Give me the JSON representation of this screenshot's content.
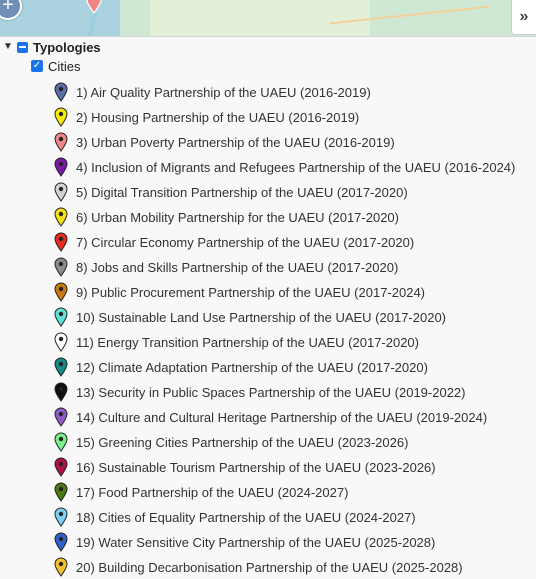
{
  "map": {
    "zoom_in_label": "+",
    "panel_toggle_label": "»"
  },
  "tree": {
    "typologies_label": "Typologies",
    "cities_label": "Cities",
    "items": [
      {
        "label": "1) Air Quality Partnership of the UAEU (2016-2019)",
        "color": "#5a6ea8",
        "icon": "map-pin-icon"
      },
      {
        "label": "2) Housing Partnership of the UAEU (2016-2019)",
        "color": "#f5ec0b",
        "icon": "map-pin-icon"
      },
      {
        "label": "3) Urban Poverty Partnership of the UAEU (2016-2019)",
        "color": "#f08585",
        "icon": "map-pin-icon"
      },
      {
        "label": "4) Inclusion of Migrants and Refugees Partnership of the UAEU (2016-2024)",
        "color": "#7a1aa6",
        "icon": "map-pin-icon"
      },
      {
        "label": "5) Digital Transition Partnership of the UAEU (2017-2020)",
        "color": "#d4d4d4",
        "icon": "map-pin-icon"
      },
      {
        "label": "6) Urban Mobility Partnership for the UAEU (2017-2020)",
        "color": "#f4e017",
        "icon": "map-pin-icon"
      },
      {
        "label": "7) Circular Economy Partnership of the UAEU (2017-2020)",
        "color": "#ea2a1e",
        "icon": "map-pin-icon"
      },
      {
        "label": "8) Jobs and Skills Partnership of the UAEU (2017-2020)",
        "color": "#8c8c8c",
        "icon": "map-pin-icon"
      },
      {
        "label": "9) Public Procurement Partnership of the UAEU (2017-2024)",
        "color": "#c97a10",
        "icon": "map-pin-icon"
      },
      {
        "label": "10) Sustainable Land Use Partnership of the UAEU (2017-2020)",
        "color": "#5fe0da",
        "icon": "map-pin-icon"
      },
      {
        "label": "11) Energy Transition Partnership of the UAEU (2017-2020)",
        "color": "#ffffff",
        "icon": "map-pin-icon"
      },
      {
        "label": "12) Climate Adaptation Partnership of the UAEU (2017-2020)",
        "color": "#168a84",
        "icon": "map-pin-icon"
      },
      {
        "label": "13) Security in Public Spaces Partnership of the UAEU (2019-2022)",
        "color": "#111111",
        "icon": "map-pin-icon"
      },
      {
        "label": "14) Culture and Cultural Heritage Partnership of the UAEU (2019-2024)",
        "color": "#8e5ac8",
        "icon": "map-pin-icon"
      },
      {
        "label": "15) Greening Cities Partnership of the UAEU (2023-2026)",
        "color": "#7df08a",
        "icon": "map-pin-icon"
      },
      {
        "label": "16) Sustainable Tourism Partnership of the UAEU (2023-2026)",
        "color": "#b0124e",
        "icon": "map-pin-icon"
      },
      {
        "label": "17) Food Partnership of the UAEU (2024-2027)",
        "color": "#4a7a12",
        "icon": "map-pin-icon"
      },
      {
        "label": "18) Cities of Equality Partnership of the UAEU (2024-2027)",
        "color": "#7fd0f5",
        "icon": "map-pin-icon"
      },
      {
        "label": "19) Water Sensitive City Partnership of the UAEU (2025-2028)",
        "color": "#3360c8",
        "icon": "map-pin-icon"
      },
      {
        "label": "20) Building Decarbonisation Partnership of the UAEU (2025-2028)",
        "color": "#f2c12e",
        "icon": "map-pin-icon"
      }
    ]
  }
}
